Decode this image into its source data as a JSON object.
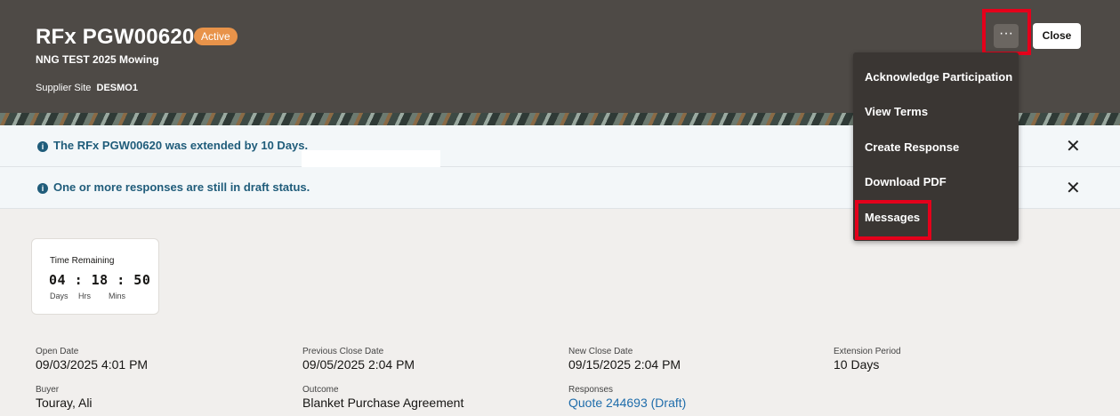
{
  "header": {
    "title": "RFx PGW00620",
    "status": "Active",
    "subtitle": "NNG TEST 2025 Mowing",
    "site_label": "Supplier Site",
    "site_value": "DESMO1",
    "more_label": "···",
    "close_label": "Close"
  },
  "banners": [
    {
      "text": "The RFx PGW00620 was extended by 10 Days."
    },
    {
      "text": "One or more responses are still in draft status."
    }
  ],
  "menu": {
    "items": [
      {
        "label": "Acknowledge Participation"
      },
      {
        "label": "View Terms"
      },
      {
        "label": "Create Response"
      },
      {
        "label": "Download PDF"
      },
      {
        "label": "Messages"
      }
    ]
  },
  "timer": {
    "label": "Time Remaining",
    "value": "04 : 18 : 50",
    "units": [
      "Days",
      "Hrs",
      "Mins"
    ]
  },
  "details": {
    "open_date": {
      "label": "Open Date",
      "value": "09/03/2025 4:01 PM"
    },
    "prev_close": {
      "label": "Previous Close Date",
      "value": "09/05/2025 2:04 PM"
    },
    "new_close": {
      "label": "New Close Date",
      "value": "09/15/2025 2:04 PM"
    },
    "extension": {
      "label": "Extension Period",
      "value": "10 Days"
    },
    "buyer": {
      "label": "Buyer",
      "value": "Touray, Ali"
    },
    "outcome": {
      "label": "Outcome",
      "value": "Blanket Purchase Agreement"
    },
    "responses": {
      "label": "Responses",
      "value": "Quote 244693 (Draft)"
    }
  }
}
